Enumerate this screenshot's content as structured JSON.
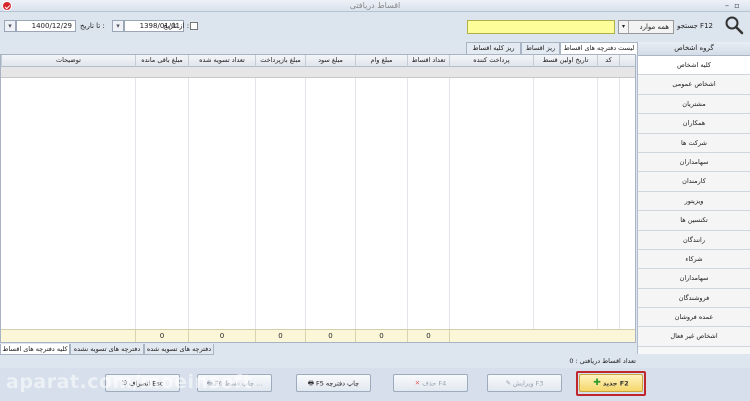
{
  "window": {
    "title": "اقساط دریافتی"
  },
  "filters": {
    "from_label": "از تاریخ :",
    "from_date": "1398/01/01",
    "to_label": "تا تاریخ :",
    "to_date": "1400/12/29",
    "search_label": "جستجو F12",
    "search_value": "",
    "search_scope": "همه موارد"
  },
  "sidebar": {
    "header": "گروه اشخاص",
    "items": [
      "کلیه اشخاص",
      "اشخاص عمومی",
      "مشتریان",
      "همکاران",
      "شرکت ها",
      "سهامداران",
      "کارمندان",
      "ویزیتور",
      "تکنسین ها",
      "رانندگان",
      "شرکاء",
      "سهامداران",
      "فروشندگان",
      "عمده فروشان",
      "اشخاص غیر فعال"
    ]
  },
  "tabs": [
    "لیست دفترچه های اقساط",
    "ریز اقساط",
    "ریز کلیه اقساط"
  ],
  "grid": {
    "columns": [
      "کد",
      "تاریخ اولین قسط",
      "پرداخت کننده",
      "تعداد اقساط",
      "مبلغ وام",
      "مبلغ سود",
      "مبلغ بازپرداخت",
      "تعداد تسویه شده",
      "مبلغ باقی مانده",
      "توضیحات"
    ],
    "totals": [
      "0",
      "0",
      "0",
      "0",
      "0",
      "0"
    ]
  },
  "bottom_tabs": [
    "کلیه دفترچه های اقساط",
    "دفترچه های تسویه نشده",
    "دفترچه های تسویه شده"
  ],
  "status": {
    "label": "تعداد اقساط دریافتی :",
    "value": "0"
  },
  "buttons": {
    "new": "جدید F2",
    "edit": "ویرایش F3",
    "delete": "حذف F4",
    "print_booklet": "F5 چاپ دفترچه",
    "print_installment": "F6 چاپ قسط ...",
    "cancel": "انصراف Esc"
  },
  "watermark": "aparat.com/moeinsoft"
}
